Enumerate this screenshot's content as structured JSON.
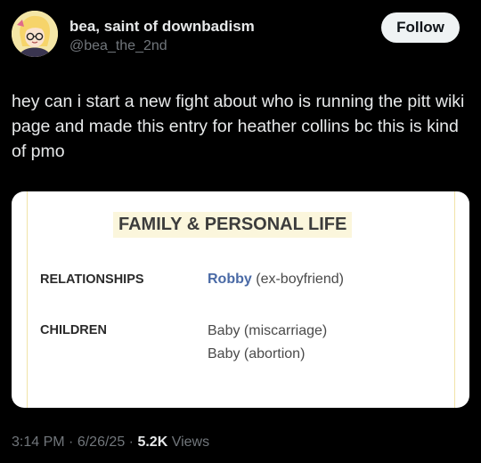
{
  "author": {
    "display_name": "bea, saint of downbadism",
    "handle": "@bea_the_2nd"
  },
  "follow_label": "Follow",
  "tweet_text": "hey can i start a new fight about who is running the pitt wiki page and made this entry for heather collins bc this is kind of pmo",
  "card": {
    "heading": "FAMILY & PERSONAL LIFE",
    "rows": [
      {
        "label": "RELATIONSHIPS",
        "link": "Robby",
        "note": "(ex-boyfriend)"
      },
      {
        "label": "CHILDREN",
        "values": [
          "Baby (miscarriage)",
          "Baby (abortion)"
        ]
      }
    ]
  },
  "meta": {
    "time": "3:14 PM",
    "date": "6/26/25",
    "views_count": "5.2K",
    "views_label": "Views",
    "separator": "·"
  },
  "colors": {
    "background": "#000000",
    "follow_bg": "#eff3f4",
    "link": "#4a6aa6",
    "heading_highlight": "#fbf6dc"
  },
  "icons": {
    "avatar": "cartoon-avatar-blonde-glasses"
  }
}
